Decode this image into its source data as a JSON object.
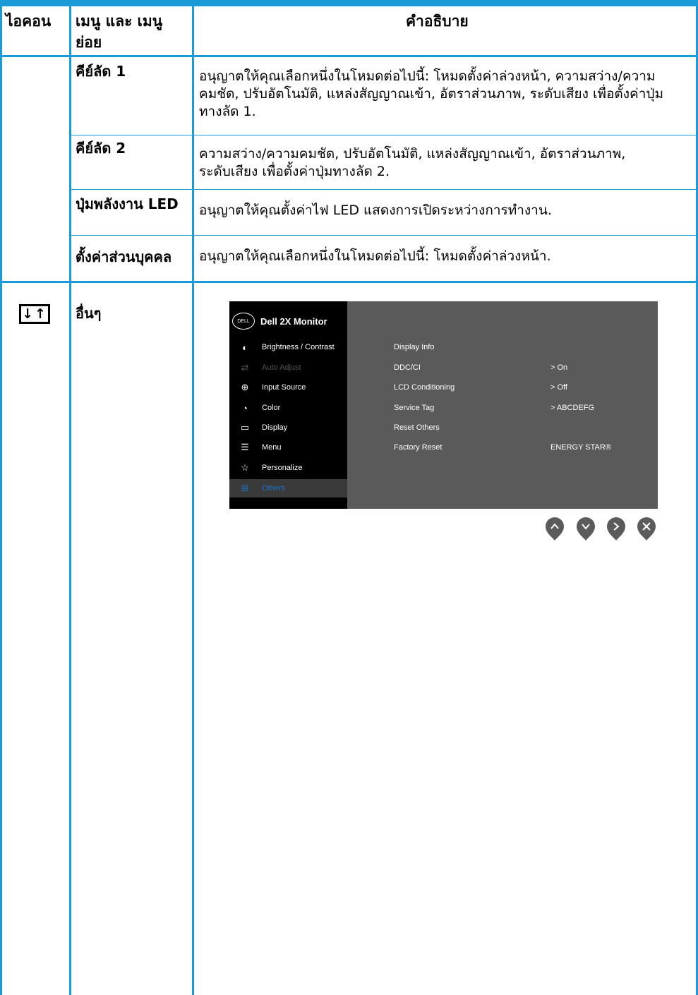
{
  "header": {
    "col_icon": "ไอคอน",
    "col_menu": "เมนู และ เมนูย่อย",
    "col_desc": "คำอธิบาย"
  },
  "rows": [
    {
      "title": "คีย์ลัด 1",
      "desc": "อนุญาตให้คุณเลือกหนึ่งในโหมดต่อไปนี้: โหมดตั้งค่าล่วงหน้า, ความสว่าง/ความคมชัด, ปรับอัตโนมัติ, แหล่งสัญญาณเข้า, อัตราส่วนภาพ, ระดับเสียง เพื่อตั้งค่าปุ่มทางลัด 1."
    },
    {
      "title": "คีย์ลัด 2",
      "desc": "ความสว่าง/ความคมชัด, ปรับอัตโนมัติ, แหล่งสัญญาณเข้า, อัตราส่วนภาพ, ระดับเสียง เพื่อตั้งค่าปุ่มทางลัด 2."
    },
    {
      "title": "ปุ่มพลังงาน LED",
      "desc": "อนุญาตให้คุณตั้งค่าไฟ LED แสดงการเปิดระหว่างการทำงาน."
    },
    {
      "title": "ตั้งค่าส่วนบุคคล",
      "desc": "อนุญาตให้คุณเลือกหนึ่งในโหมดต่อไปนี้: โหมดตั้งค่าล่วงหน้า."
    },
    {
      "title": "อื่นๆ",
      "icon": "others-icon"
    }
  ],
  "osd": {
    "logo": "DELL",
    "title": "Dell 2X Monitor",
    "menu": [
      {
        "label": "Brightness / Contrast",
        "icon": "brightness-icon",
        "state": "normal"
      },
      {
        "label": "Auto Adjust",
        "icon": "auto-adjust-icon",
        "state": "disabled"
      },
      {
        "label": "Input Source",
        "icon": "input-source-icon",
        "state": "normal"
      },
      {
        "label": "Color",
        "icon": "color-icon",
        "state": "normal"
      },
      {
        "label": "Display",
        "icon": "display-icon",
        "state": "normal"
      },
      {
        "label": "Menu",
        "icon": "menu-icon",
        "state": "normal"
      },
      {
        "label": "Personalize",
        "icon": "star-icon",
        "state": "normal"
      },
      {
        "label": "Others",
        "icon": "others-icon",
        "state": "active"
      }
    ],
    "options": [
      {
        "label": "Display Info",
        "value": ""
      },
      {
        "label": "DDC/CI",
        "value": ">  On"
      },
      {
        "label": "LCD Conditioning",
        "value": ">  Off"
      },
      {
        "label": "Service Tag",
        "value": ">  ABCDEFG"
      },
      {
        "label": "Reset Others",
        "value": ""
      },
      {
        "label": "Factory Reset",
        "value": "ENERGY STAR®"
      }
    ],
    "buttons": [
      "up-icon",
      "down-icon",
      "right-icon",
      "close-icon"
    ]
  },
  "colors": {
    "border": "#1a9ad6",
    "osd_bg": "#5a5a5a",
    "osd_side": "#000000",
    "osd_active": "#1a73c8"
  }
}
